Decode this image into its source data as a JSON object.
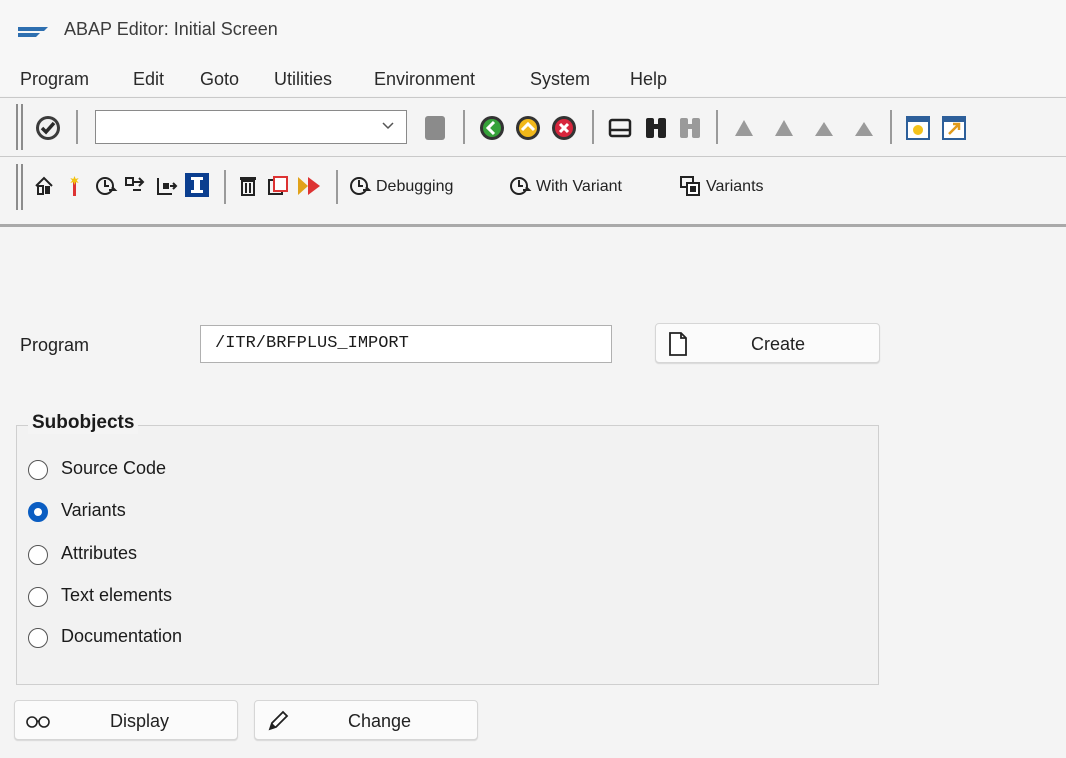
{
  "window": {
    "title": "ABAP Editor: Initial Screen"
  },
  "menu": [
    "Program",
    "Edit",
    "Goto",
    "Utilities",
    "Environment",
    "System",
    "Help"
  ],
  "toolbar": {
    "command_field_value": "",
    "app_buttons": {
      "debugging": "Debugging",
      "with_variant": "With Variant",
      "variants": "Variants"
    }
  },
  "form": {
    "program_label": "Program",
    "program_value": "/ITR/BRFPLUS_IMPORT",
    "create_label": "Create"
  },
  "subobjects": {
    "title": "Subobjects",
    "options": [
      {
        "label": "Source Code",
        "selected": false
      },
      {
        "label": "Variants",
        "selected": true
      },
      {
        "label": "Attributes",
        "selected": false
      },
      {
        "label": "Text elements",
        "selected": false
      },
      {
        "label": "Documentation",
        "selected": false
      }
    ]
  },
  "actions": {
    "display": "Display",
    "change": "Change"
  },
  "colors": {
    "accent": "#0a5dc2",
    "background": "#f4f4f4"
  }
}
